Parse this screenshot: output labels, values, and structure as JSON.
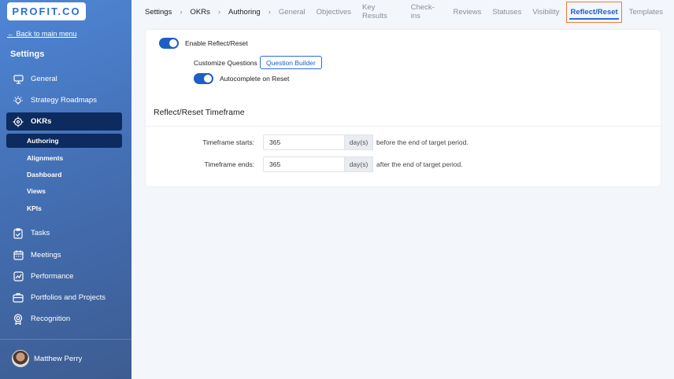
{
  "sidebar": {
    "logo": "PROFIT.CO",
    "back": "← Back to main menu",
    "title": "Settings",
    "items": [
      {
        "label": "General",
        "icon": "monitor-icon"
      },
      {
        "label": "Strategy Roadmaps",
        "icon": "lightbulb-icon"
      },
      {
        "label": "OKRs",
        "icon": "target-icon"
      },
      {
        "label": "Tasks",
        "icon": "clipboard-check-icon"
      },
      {
        "label": "Meetings",
        "icon": "calendar-icon"
      },
      {
        "label": "Performance",
        "icon": "chart-line-icon"
      },
      {
        "label": "Portfolios and Projects",
        "icon": "briefcase-icon"
      },
      {
        "label": "Recognition",
        "icon": "award-icon"
      }
    ],
    "subitems": [
      "Authoring",
      "Alignments",
      "Dashboard",
      "Views",
      "KPIs"
    ],
    "user": "Matthew Perry"
  },
  "breadcrumb": [
    "Settings",
    "OKRs",
    "Authoring"
  ],
  "tabs": [
    "General",
    "Objectives",
    "Key Results",
    "Check-ins",
    "Reviews",
    "Statuses",
    "Visibility",
    "Reflect/Reset",
    "Templates"
  ],
  "card": {
    "enable_label": "Enable Reflect/Reset",
    "enable_on": true,
    "customize_label": "Customize Questions",
    "question_builder": "Question Builder",
    "autocomplete_label": "Autocomplete on Reset",
    "autocomplete_on": true,
    "section_title": "Reflect/Reset Timeframe",
    "starts": {
      "label": "Timeframe starts:",
      "value": "365",
      "unit": "day(s)",
      "suffix": "before the end of target period."
    },
    "ends": {
      "label": "Timeframe ends:",
      "value": "365",
      "unit": "day(s)",
      "suffix": "after the end of target period."
    }
  }
}
